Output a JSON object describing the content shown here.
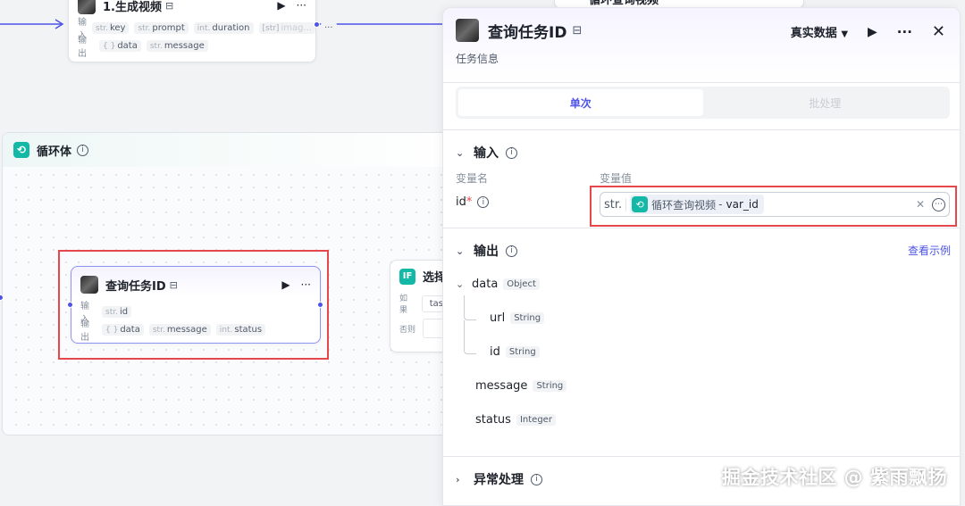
{
  "canvas": {
    "node_generate": {
      "title": "1.生成视频",
      "input_label": "输入",
      "output_label": "输出",
      "inputs": [
        {
          "type": "str.",
          "name": "key"
        },
        {
          "type": "str.",
          "name": "prompt"
        },
        {
          "type": "int.",
          "name": "duration"
        },
        {
          "type": "[str]",
          "name": "imag..."
        }
      ],
      "more": "···",
      "outputs": [
        {
          "type": "{ }",
          "name": "data"
        },
        {
          "type": "str.",
          "name": "message"
        }
      ]
    },
    "node_top_right": {
      "title": "循环查询视频"
    },
    "loop": {
      "title": "循环体"
    },
    "node_query": {
      "title": "查询任务ID",
      "input_label": "输入",
      "output_label": "输出",
      "inputs": [
        {
          "type": "str.",
          "name": "id"
        }
      ],
      "outputs": [
        {
          "type": "{ }",
          "name": "data"
        },
        {
          "type": "str.",
          "name": "message"
        },
        {
          "type": "int.",
          "name": "status"
        }
      ]
    },
    "node_if": {
      "badge": "IF",
      "title": "选择",
      "if_label": "如果",
      "if_value": "tas",
      "else_label": "否则"
    }
  },
  "panel": {
    "title": "查询任务ID",
    "subtitle": "任务信息",
    "data_mode": "真实数据",
    "tabs": [
      "单次",
      "批处理"
    ],
    "input_section": {
      "title": "输入",
      "col_name": "变量名",
      "col_value": "变量值",
      "var_name": "id",
      "required_mark": "*",
      "prefix": "str.",
      "ref_node": "循环查询视频",
      "ref_sep": "-",
      "ref_var": "var_id"
    },
    "output_section": {
      "title": "输出",
      "example_link": "查看示例",
      "items": [
        {
          "name": "data",
          "type": "Object"
        },
        {
          "name": "url",
          "type": "String"
        },
        {
          "name": "id",
          "type": "String"
        },
        {
          "name": "message",
          "type": "String"
        },
        {
          "name": "status",
          "type": "Integer"
        }
      ]
    },
    "exception_section": {
      "title": "异常处理"
    }
  },
  "watermark": "掘金技术社区 @ 紫雨飘扬",
  "colors": {
    "accent": "#4d53e8",
    "loop_teal": "#14b8a6",
    "highlight_red": "#e5474b"
  }
}
